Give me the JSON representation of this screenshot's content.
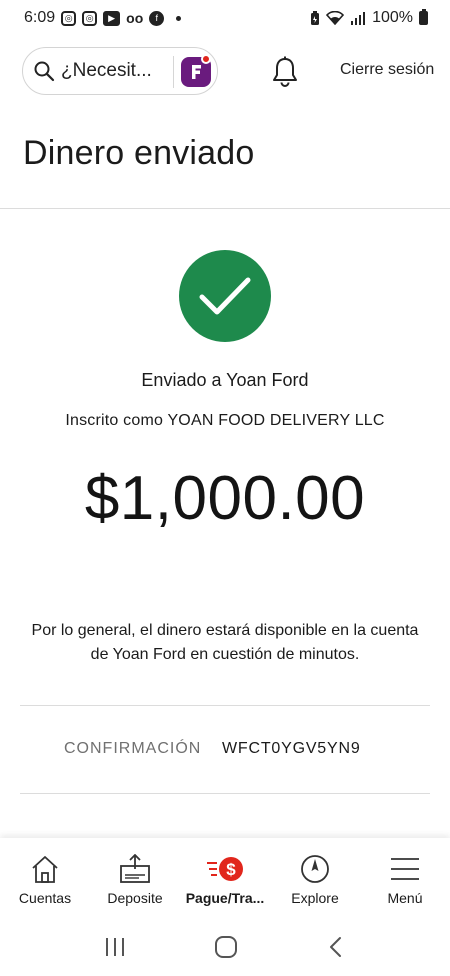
{
  "status_bar": {
    "time": "6:09",
    "battery": "100%"
  },
  "header": {
    "search_placeholder": "¿Necesit...",
    "signout_label": "Cierre sesión"
  },
  "page": {
    "title": "Dinero enviado",
    "sent_to": "Enviado a Yoan Ford",
    "enrolled_as": "Inscrito como YOAN FOOD DELIVERY LLC",
    "amount": "$1,000.00",
    "notice": "Por lo general, el dinero estará disponible en la cuenta de Yoan Ford en cuestión de minutos.",
    "confirmation_label": "CONFIRMACIÓN",
    "confirmation_value": "WFCT0YGV5YN9"
  },
  "tabs": [
    {
      "label": "Cuentas",
      "icon": "house-icon"
    },
    {
      "label": "Deposite",
      "icon": "deposit-icon"
    },
    {
      "label": "Pague/Tra...",
      "icon": "pay-transfer-icon",
      "active": true
    },
    {
      "label": "Explore",
      "icon": "compass-icon"
    },
    {
      "label": "Menú",
      "icon": "hamburger-menu-icon"
    }
  ],
  "colors": {
    "success_green": "#1e8a4c",
    "brand_red": "#e1261c",
    "fargo_purple": "#6a1b7e"
  }
}
